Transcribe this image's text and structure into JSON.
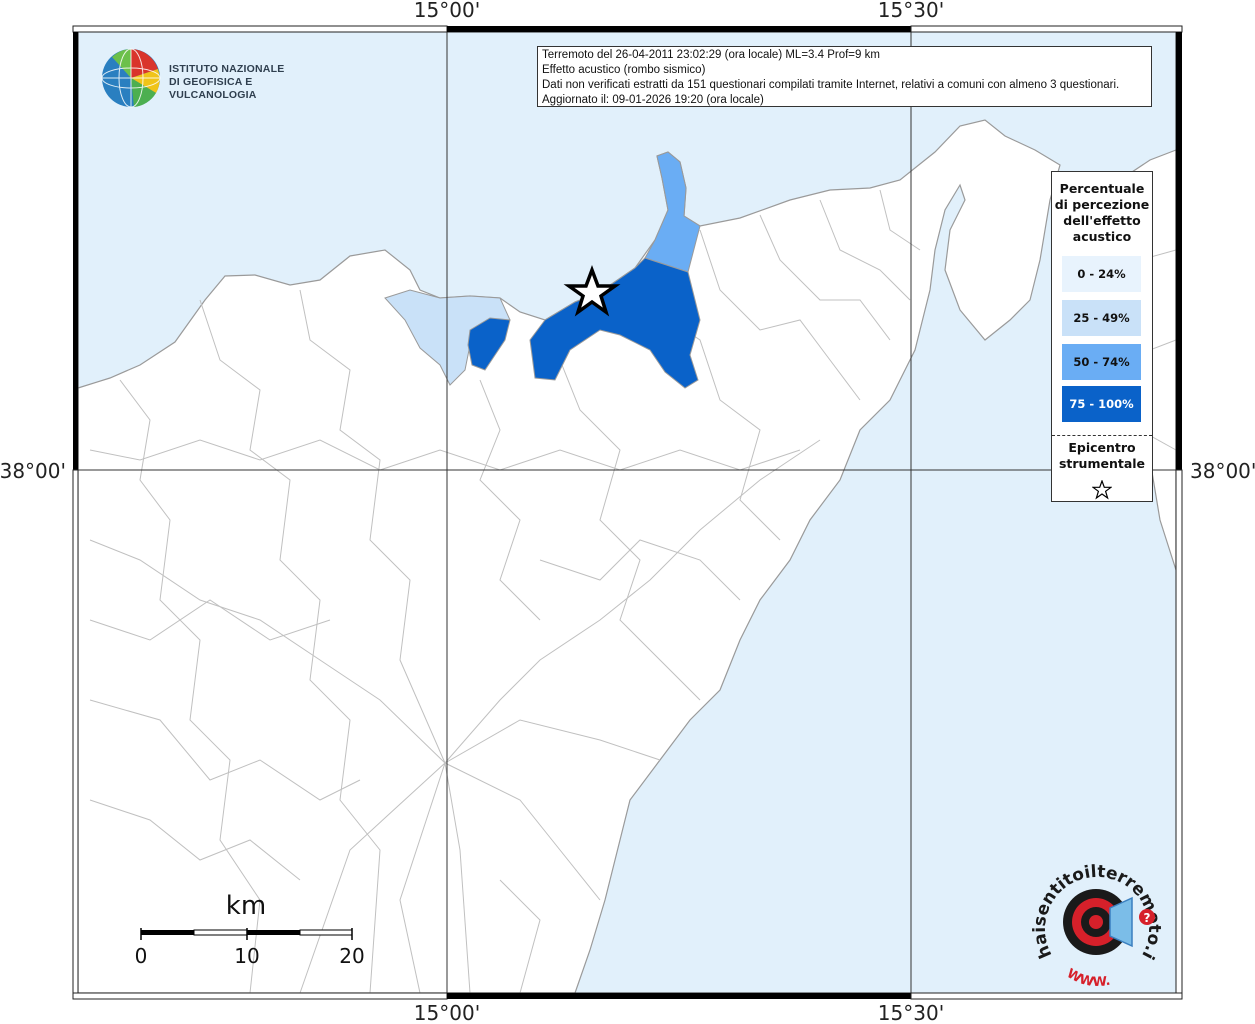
{
  "header": {
    "line1": "Terremoto del 26-04-2011 23:02:29 (ora locale) ML=3.4 Prof=9 km",
    "line2": "Effetto acustico (rombo sismico)",
    "line3": "Dati non verificati estratti da 151 questionari compilati tramite Internet, relativi a comuni con almeno 3 questionari.",
    "line4": "Aggiornato il: 09-01-2026 19:20 (ora locale)"
  },
  "logo": {
    "line1": "ISTITUTO NAZIONALE",
    "line2": "DI GEOFISICA E VULCANOLOGIA"
  },
  "coords": {
    "top_left": "15°00'",
    "top_right": "15°30'",
    "bottom_left": "15°00'",
    "bottom_right": "15°30'",
    "left_lat": "38°00'",
    "right_lat": "38°00'"
  },
  "legend": {
    "title_lines": [
      "Percentuale",
      "di percezione",
      "dell'effetto",
      "acustico"
    ],
    "classes": [
      {
        "label": "0 - 24%",
        "color": "#e8f3fd"
      },
      {
        "label": "25 - 49%",
        "color": "#c9e1f8"
      },
      {
        "label": "50 - 74%",
        "color": "#6aadf4"
      },
      {
        "label": "75 - 100%",
        "color": "#0a62c9"
      }
    ],
    "epicenter_lines": [
      "Epicentro",
      "strumentale"
    ],
    "epicenter_icon": "star-outline-icon"
  },
  "scale": {
    "unit": "km",
    "ticks": [
      "0",
      "10",
      "20"
    ]
  },
  "colors": {
    "sea": "#e1f0fb",
    "land": "#ffffff",
    "boundary": "#b9b9b9",
    "grid": "#333333"
  },
  "watermark": {
    "text": "haisentitoilterremoto.it",
    "url_text": "WWW."
  }
}
